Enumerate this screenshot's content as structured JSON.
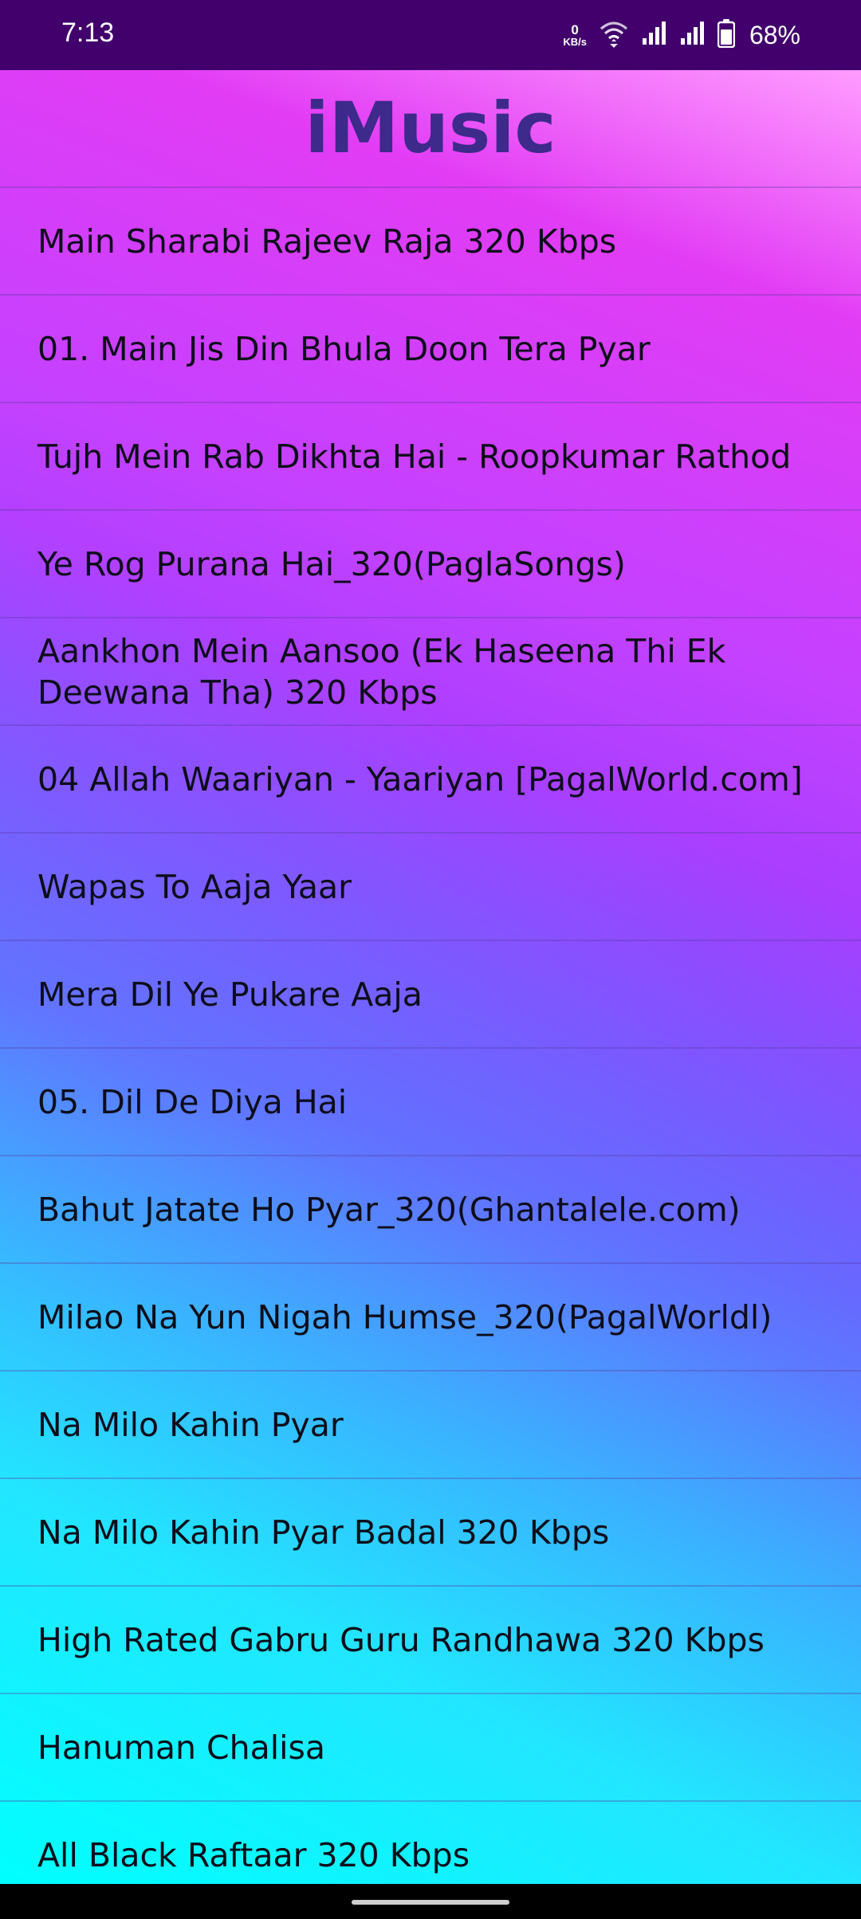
{
  "status_bar": {
    "time": "7:13",
    "net_speed_value": "0",
    "net_speed_unit": "KB/s",
    "battery_percent": "68%"
  },
  "app": {
    "title": "iMusic"
  },
  "songs": [
    "Main Sharabi Rajeev Raja 320 Kbps",
    "01. Main Jis Din Bhula Doon Tera Pyar",
    "Tujh Mein Rab Dikhta Hai - Roopkumar Rathod",
    "Ye Rog Purana Hai_320(PaglaSongs)",
    "Aankhon Mein Aansoo (Ek Haseena Thi Ek Deewana Tha) 320 Kbps",
    "04 Allah Waariyan - Yaariyan [PagalWorld.com]",
    "Wapas To Aaja Yaar",
    "Mera Dil Ye Pukare Aaja",
    "05. Dil De Diya Hai",
    "Bahut Jatate Ho Pyar_320(Ghantalele.com)",
    "Milao Na Yun Nigah Humse_320(PagalWorldl)",
    "Na Milo Kahin Pyar",
    "Na Milo Kahin Pyar Badal 320 Kbps",
    "High Rated Gabru Guru Randhawa 320 Kbps",
    "Hanuman Chalisa",
    "All Black Raftaar 320 Kbps"
  ],
  "colors": {
    "status_bar_bg": "#41006b",
    "title_color": "#3d2a8a",
    "text_color": "#0d0d1a"
  },
  "icons": {
    "wifi": "wifi-icon",
    "signal1": "signal-icon",
    "signal2": "signal-icon",
    "battery": "battery-icon"
  }
}
